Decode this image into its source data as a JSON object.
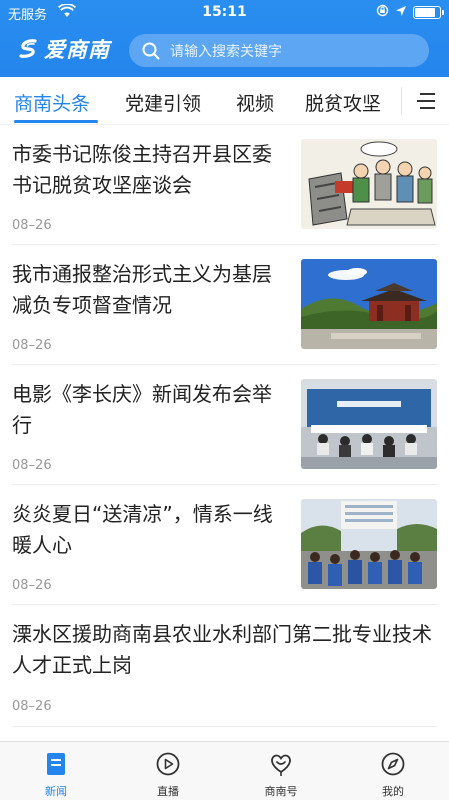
{
  "status_bar": {
    "carrier": "无服务",
    "time": "15:11",
    "battery_level": 0.85
  },
  "header": {
    "app_name": "爱商南",
    "search_placeholder": "请输入搜索关键字"
  },
  "tabs": [
    {
      "label": "商南头条",
      "active": true
    },
    {
      "label": "党建引领",
      "active": false
    },
    {
      "label": "视频",
      "active": false
    },
    {
      "label": "脱贫攻坚",
      "active": false
    }
  ],
  "news": [
    {
      "title": "市委书记陈俊主持召开县区委书记脱贫攻坚座谈会",
      "date": "08–26",
      "image": "cartoon-illustration"
    },
    {
      "title": "我市通报整治形式主义为基层减负专项督查情况",
      "date": "08–26",
      "image": "pavilion-landscape"
    },
    {
      "title": "电影《李长庆》新闻发布会举行",
      "date": "08–26",
      "image": "press-conference"
    },
    {
      "title": "炎炎夏日“送清凉”，情系一线暖人心",
      "date": "08–26",
      "image": "workers-group"
    },
    {
      "title": "溧水区援助商南县农业水利部门第二批专业技术人才正式上岗",
      "date": "08–26",
      "image": null
    }
  ],
  "bottom_nav": [
    {
      "label": "新闻",
      "icon": "news-icon",
      "active": true
    },
    {
      "label": "直播",
      "icon": "live-icon",
      "active": false
    },
    {
      "label": "商南号",
      "icon": "shangnan-hao-icon",
      "active": false
    },
    {
      "label": "我的",
      "icon": "compass-icon",
      "active": false
    }
  ],
  "colors": {
    "brand_blue": "#2485ec",
    "text": "#222222",
    "muted": "#999999"
  }
}
